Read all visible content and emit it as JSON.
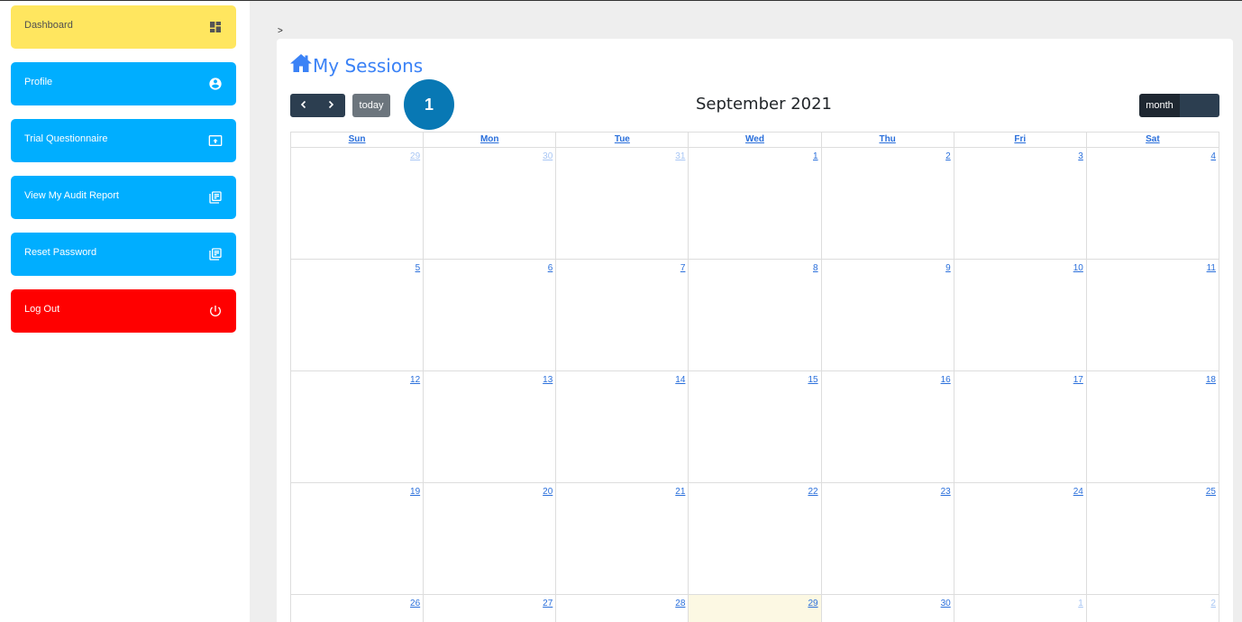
{
  "sidebar": {
    "items": [
      {
        "label": "Dashboard",
        "icon": "dashboard-icon"
      },
      {
        "label": "Profile",
        "icon": "account-circle-icon"
      },
      {
        "label": "Trial Questionnaire",
        "icon": "upload-box-icon"
      },
      {
        "label": "View My Audit Report",
        "icon": "library-books-icon"
      },
      {
        "label": "Reset Password",
        "icon": "library-books-icon"
      },
      {
        "label": "Log Out",
        "icon": "power-icon"
      }
    ],
    "colors": {
      "dashboard": "#ffe65f",
      "default": "#00aeff",
      "logout": "#ff0000"
    }
  },
  "breadcrumb": ">",
  "page": {
    "title": "My Sessions",
    "title_icon": "home-icon"
  },
  "calendar": {
    "prev_icon": "chevron-left-icon",
    "next_icon": "chevron-right-icon",
    "today_label": "today",
    "badge": "1",
    "month_title": "September 2021",
    "view_month_label": "month",
    "weekdays": [
      "Sun",
      "Mon",
      "Tue",
      "Wed",
      "Thu",
      "Fri",
      "Sat"
    ],
    "weeks": [
      [
        {
          "d": "29",
          "other": true
        },
        {
          "d": "30",
          "other": true
        },
        {
          "d": "31",
          "other": true
        },
        {
          "d": "1"
        },
        {
          "d": "2"
        },
        {
          "d": "3"
        },
        {
          "d": "4"
        }
      ],
      [
        {
          "d": "5"
        },
        {
          "d": "6"
        },
        {
          "d": "7"
        },
        {
          "d": "8"
        },
        {
          "d": "9"
        },
        {
          "d": "10"
        },
        {
          "d": "11"
        }
      ],
      [
        {
          "d": "12"
        },
        {
          "d": "13"
        },
        {
          "d": "14"
        },
        {
          "d": "15"
        },
        {
          "d": "16"
        },
        {
          "d": "17"
        },
        {
          "d": "18"
        }
      ],
      [
        {
          "d": "19"
        },
        {
          "d": "20"
        },
        {
          "d": "21"
        },
        {
          "d": "22"
        },
        {
          "d": "23"
        },
        {
          "d": "24"
        },
        {
          "d": "25"
        }
      ],
      [
        {
          "d": "26"
        },
        {
          "d": "27"
        },
        {
          "d": "28"
        },
        {
          "d": "29",
          "today": true
        },
        {
          "d": "30"
        },
        {
          "d": "1",
          "other": true
        },
        {
          "d": "2",
          "other": true
        }
      ]
    ]
  }
}
